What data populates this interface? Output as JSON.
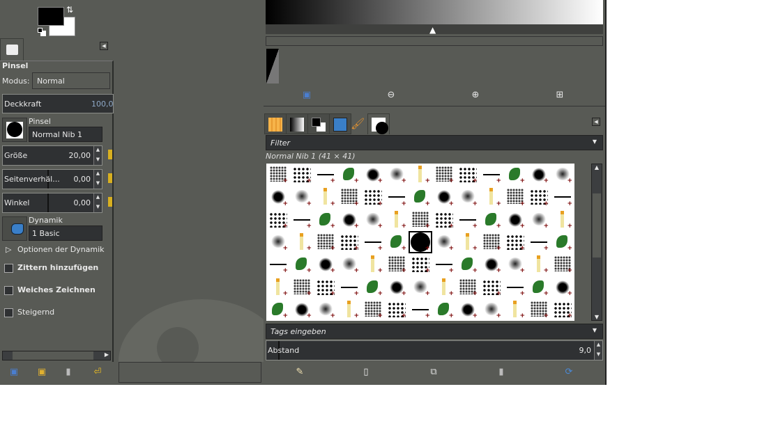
{
  "toolbox": {
    "fg_color": "#000000",
    "bg_color": "#ffffff"
  },
  "tool_options": {
    "title": "Pinsel",
    "mode_label": "Modus:",
    "mode_value": "Normal",
    "opacity_label": "Deckkraft",
    "opacity_value": "100,0",
    "brush_label": "Pinsel",
    "brush_value": "Normal Nib 1",
    "size_label": "Größe",
    "size_value": "20,00",
    "aspect_label": "Seitenverhäl...",
    "aspect_value": "0,00",
    "angle_label": "Winkel",
    "angle_value": "0,00",
    "dynamics_label": "Dynamik",
    "dynamics_value": "1 Basic",
    "dynamics_options": "Optionen der Dynamik",
    "jitter": "Zittern hinzufügen",
    "smooth": "Weiches Zeichnen",
    "incremental": "Steigernd"
  },
  "brushes": {
    "filter_placeholder": "Filter",
    "selected": "Normal Nib 1 (41 × 41)",
    "tags_placeholder": "Tags eingeben",
    "spacing_label": "Abstand",
    "spacing_value": "9,0"
  }
}
